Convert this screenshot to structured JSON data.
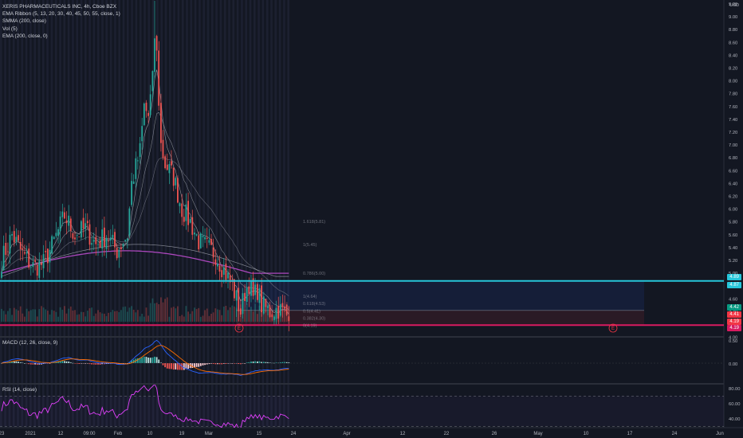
{
  "legend": {
    "title": "XERIS PHARMACEUTICALS INC, 4h, Cboe BZX",
    "indicators": [
      "EMA Ribbon (5, 13, 20, 30, 40, 45, 50, 55, close, 1)",
      "SMMA (200, close)",
      "Vol (5)",
      "EMA (200, close, 0)"
    ]
  },
  "price_axis": {
    "currency": "USD",
    "ticks": [
      "9.20",
      "8.80",
      "8.40",
      "8.00",
      "7.60",
      "7.20",
      "6.80",
      "6.40",
      "6.00",
      "5.60",
      "5.20",
      "4.80",
      "4.40",
      "4.00"
    ],
    "ticks_extra": [
      "9.00",
      "8.60",
      "8.20",
      "7.80",
      "7.40",
      "7.00",
      "6.60",
      "6.20",
      "5.80",
      "5.40",
      "5.00",
      "4.60",
      "4.20"
    ]
  },
  "price_labels": [
    {
      "text": "4.89",
      "color": "#26c6da"
    },
    {
      "text": "4.87",
      "color": "#26c6da"
    },
    {
      "text": "4.42",
      "color": "#089981"
    },
    {
      "text": "4.41",
      "color": "#f23645"
    },
    {
      "text": "4.19",
      "color": "#f23645"
    },
    {
      "text": "4.19",
      "color": "#d81b60"
    }
  ],
  "fib_labels": [
    "1.618(5.81)",
    "1(5.45)",
    "0.786(5.00)",
    "1(4.64)",
    "0.618(4.53)",
    "0.5(4.41)",
    "0.382(4.30)",
    "0(4.19)"
  ],
  "markers": [
    "E",
    "E"
  ],
  "time_axis": [
    "23",
    "2021",
    "12",
    "09:00",
    "Feb",
    "10",
    "19",
    "Mar",
    "15",
    "24",
    "Apr",
    "12",
    "22",
    "26",
    "May",
    "10",
    "17",
    "24",
    "Jun"
  ],
  "macd": {
    "title": "MACD (12, 26, close, 9)",
    "ticks": [
      "0.50",
      "0.00"
    ]
  },
  "rsi": {
    "title": "RSI (14, close)",
    "ticks": [
      "80.00",
      "60.00",
      "40.00"
    ]
  },
  "colors": {
    "background": "#131722",
    "up": "#26a69a",
    "down": "#ef5350",
    "cyan_line": "#26c6da",
    "magenta_line": "#d81b60",
    "smma": "#ab47bc",
    "rsi": "#e040fb",
    "macd": "#2962ff",
    "signal": "#ff6d00"
  }
}
